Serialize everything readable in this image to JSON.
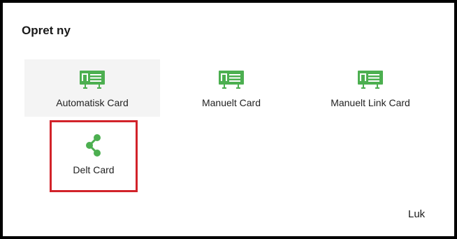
{
  "dialog": {
    "title": "Opret ny",
    "close_label": "Luk"
  },
  "options": [
    {
      "label": "Automatisk Card",
      "icon": "card-icon"
    },
    {
      "label": "Manuelt Card",
      "icon": "card-icon"
    },
    {
      "label": "Manuelt Link Card",
      "icon": "card-icon"
    },
    {
      "label": "Delt Card",
      "icon": "share-icon"
    }
  ],
  "colors": {
    "icon_green": "#4caf50",
    "highlight_red": "#d2232a",
    "hover_bg": "#f4f4f4"
  }
}
